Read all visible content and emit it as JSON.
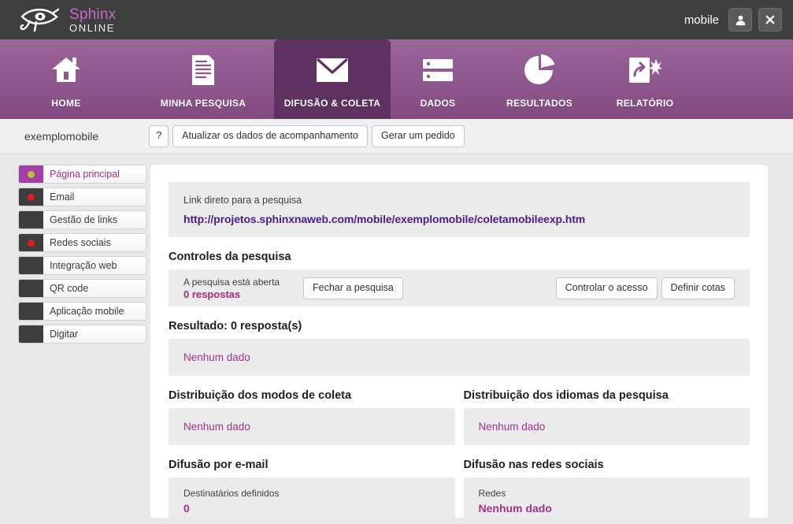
{
  "topbar": {
    "logo_primary": "Sphinx",
    "logo_secondary": "ONLINE",
    "logo_icon": "eye-of-horus-icon",
    "user_name": "mobile",
    "account_icon": "user-icon",
    "close_icon": "close-icon"
  },
  "nav": {
    "items": [
      {
        "label": "HOME",
        "icon": "house-icon",
        "active": false
      },
      {
        "label": "MINHA PESQUISA",
        "icon": "document-lines-icon",
        "active": false
      },
      {
        "label": "DIFUSÃO & COLETA",
        "icon": "envelope-icon",
        "active": true
      },
      {
        "label": "DADOS",
        "icon": "database-rows-icon",
        "active": false
      },
      {
        "label": "RESULTADOS",
        "icon": "pie-chart-icon",
        "active": false
      },
      {
        "label": "RELATÓRIO",
        "icon": "share-report-icon",
        "active": false
      }
    ]
  },
  "breadcrumb": {
    "title": "exemplomobile",
    "help_label": "?",
    "refresh_label": "Atualizar os dados de acompanhamento",
    "order_label": "Gerar um pedido"
  },
  "sidebar": {
    "items": [
      {
        "label": "Página principal",
        "status": "green",
        "active": true
      },
      {
        "label": "Email",
        "status": "red",
        "active": false
      },
      {
        "label": "Gestão de links",
        "status": "none",
        "active": false
      },
      {
        "label": "Redes sociais",
        "status": "red",
        "active": false
      },
      {
        "label": "Integração web",
        "status": "none",
        "active": false
      },
      {
        "label": "QR code",
        "status": "none",
        "active": false
      },
      {
        "label": "Aplicação mobile",
        "status": "none",
        "active": false
      },
      {
        "label": "Digitar",
        "status": "none",
        "active": false
      }
    ]
  },
  "main": {
    "direct_link": {
      "label": "Link direto para a pesquisa",
      "url": "http://projetos.sphinxnaweb.com/mobile/exemplomobile/coletamobileexp.htm"
    },
    "controls": {
      "title": "Controles da pesquisa",
      "status_line": "A pesquisa está aberta",
      "responses": "0 respostas",
      "close_survey_label": "Fechar a pesquisa",
      "access_control_label": "Controlar o acesso",
      "quotas_label": "Definir cotas"
    },
    "result": {
      "title": "Resultado: 0 resposta(s)",
      "value": "Nenhum dado"
    },
    "collection_modes": {
      "title": "Distribuição dos modos de coleta",
      "value": "Nenhum dado"
    },
    "survey_languages": {
      "title": "Distribuição dos idiomas da pesquisa",
      "value": "Nenhum dado"
    },
    "email_diffusion": {
      "title": "Difusão por e-mail",
      "kv_label": "Destinatários definidos",
      "kv_value": "0"
    },
    "social_diffusion": {
      "title": "Difusão nas redes sociais",
      "kv_label": "Redes",
      "kv_value": "Nenhum dado"
    }
  },
  "colors": {
    "brand_purple": "#8d578e",
    "active_tab": "#5e3160",
    "accent_magenta": "#a3338c",
    "link_violet": "#4a1d8e",
    "topbar_dark": "#3f3f3f",
    "page_bg": "#e8e8e9",
    "panel_bg": "#ebebeb",
    "status_green": "#b5c334",
    "status_red": "#d62020"
  }
}
